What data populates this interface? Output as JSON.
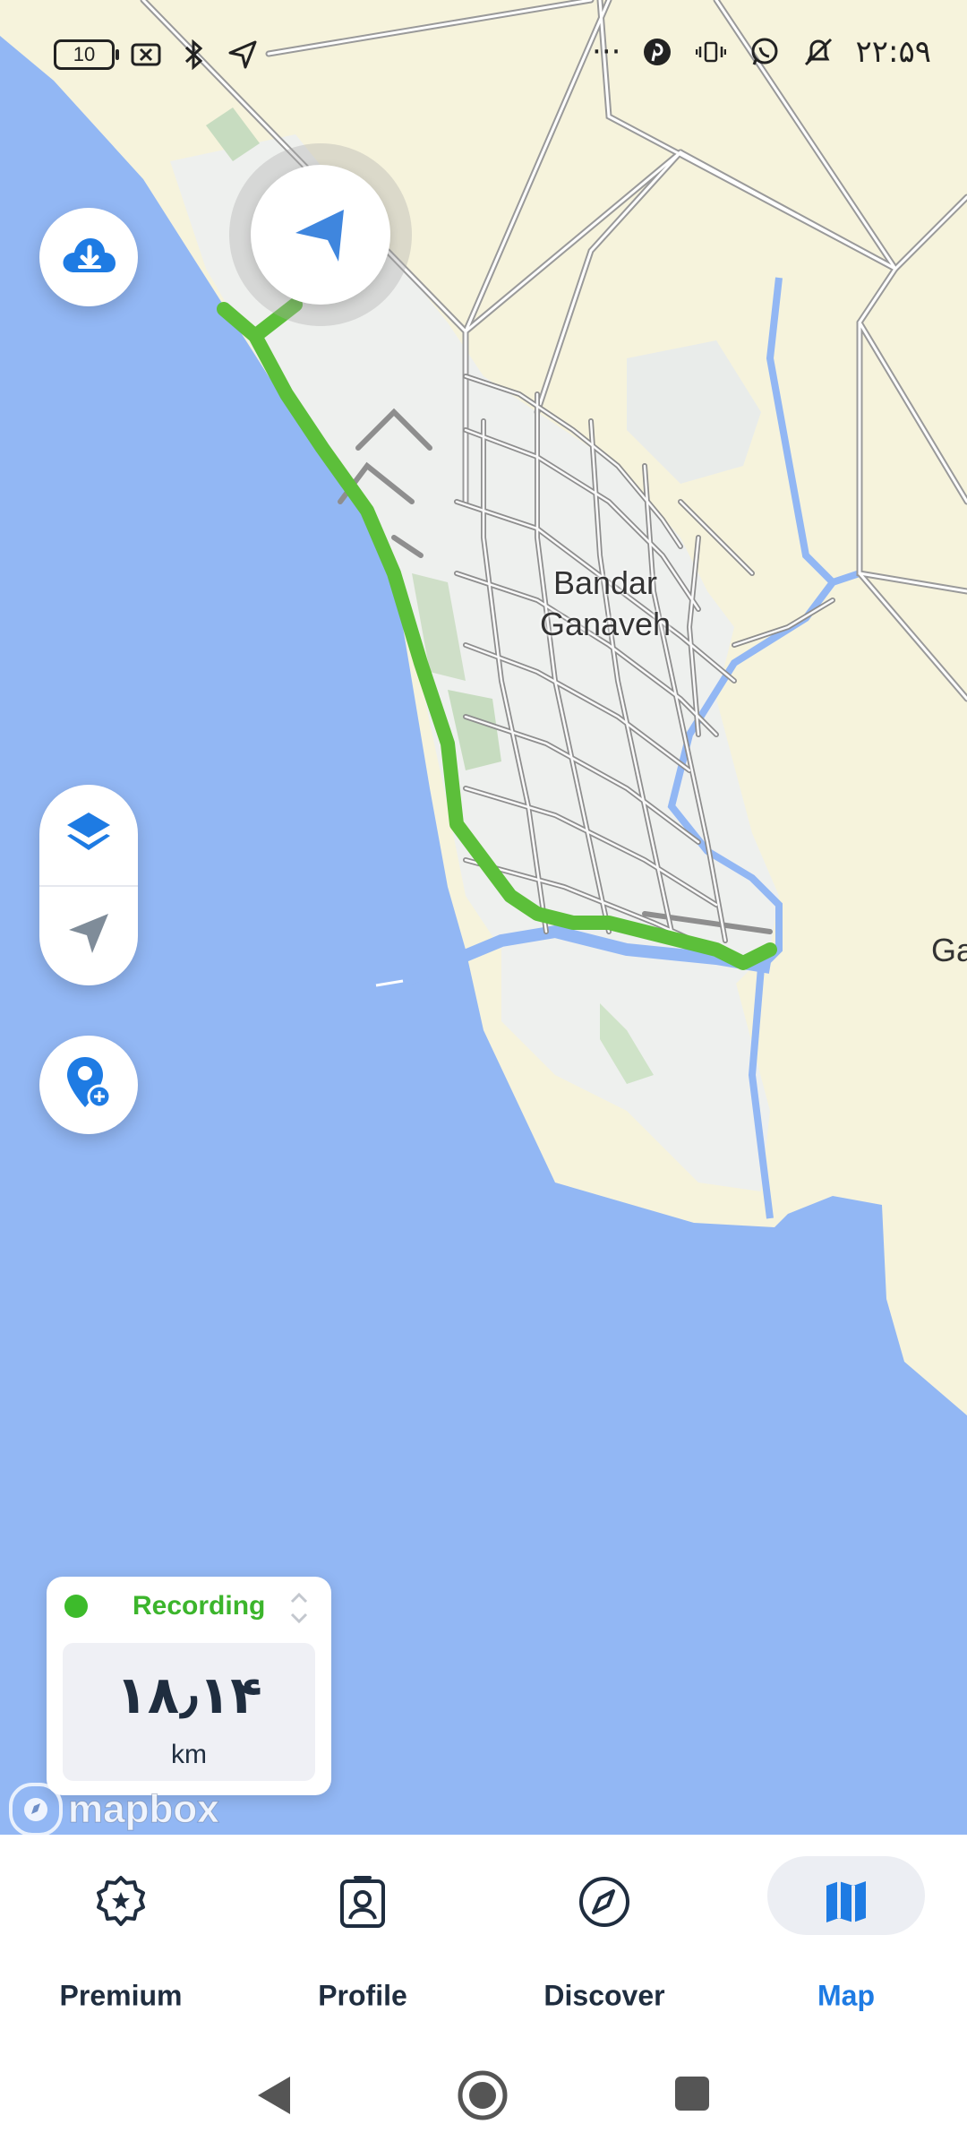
{
  "status_bar": {
    "battery": "10",
    "time": "۲۲:۵۹",
    "more": "···"
  },
  "map": {
    "city_label": "Bandar Ganaveh",
    "edge_label": "Ga",
    "attribution": "mapbox",
    "colors": {
      "water": "#92b7f4",
      "land": "#f6f3dc",
      "urban": "#eef0ee",
      "route": "#5cbf3a",
      "accent": "#1e7be3"
    }
  },
  "controls": {
    "download_icon": "cloud-download-icon",
    "layers_icon": "layers-icon",
    "locate_icon": "navigation-arrow-icon",
    "add_place_icon": "add-location-icon"
  },
  "recording": {
    "status": "Recording",
    "distance": "۱۸٫۱۴",
    "unit": "km"
  },
  "bottom_nav": {
    "tabs": [
      {
        "label": "Premium",
        "icon": "star-badge-icon"
      },
      {
        "label": "Profile",
        "icon": "profile-badge-icon"
      },
      {
        "label": "Discover",
        "icon": "compass-icon"
      },
      {
        "label": "Map",
        "icon": "map-icon",
        "active": true
      }
    ]
  }
}
